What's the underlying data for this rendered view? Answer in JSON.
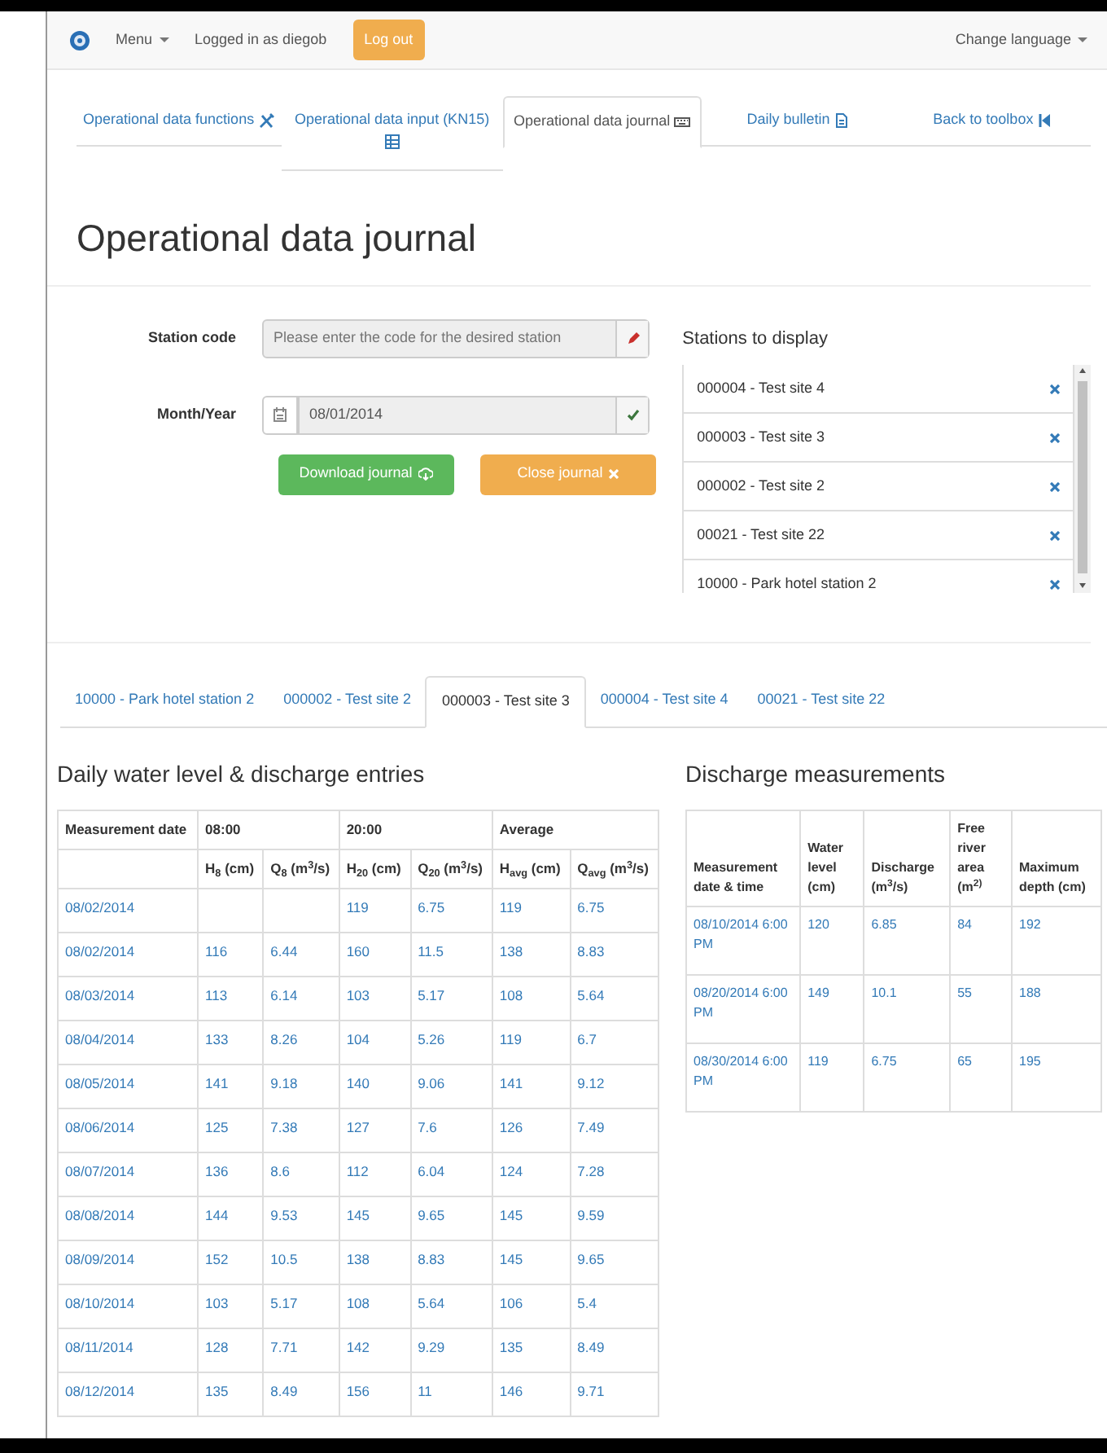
{
  "navbar": {
    "menu": "Menu",
    "user": "Logged in as diegob",
    "logout": "Log out",
    "language": "Change language"
  },
  "tabs": [
    {
      "label": "Operational data functions",
      "selected": false
    },
    {
      "label": "Operational data input (KN15)",
      "selected": false
    },
    {
      "label": "Operational data journal",
      "selected": true
    },
    {
      "label": "Daily bulletin",
      "selected": false
    },
    {
      "label": "Back to toolbox",
      "selected": false
    }
  ],
  "title": "Operational data journal",
  "form": {
    "station_code": {
      "label": "Station code",
      "placeholder": "Please enter the code for the desired station"
    },
    "month_year": {
      "label": "Month/Year",
      "value": "08/01/2014"
    },
    "buttons": [
      {
        "label": "Download journal",
        "kind": "download"
      },
      {
        "label": "Close journal",
        "kind": "close"
      }
    ]
  },
  "stations_panel": {
    "title": "Stations to display",
    "items": [
      "000004 - Test site 4",
      "000003 - Test site 3",
      "000002 - Test site 2",
      "00021 - Test site 22",
      "10000 - Park hotel station 2"
    ]
  },
  "station_tabs": [
    {
      "label": "10000 - Park hotel station 2",
      "selected": false
    },
    {
      "label": "000002 - Test site 2",
      "selected": false
    },
    {
      "label": "000003 - Test site 3",
      "selected": true
    },
    {
      "label": "000004 - Test site 4",
      "selected": false
    },
    {
      "label": "00021 - Test site 22",
      "selected": false
    }
  ],
  "daily": {
    "title": "Daily water level & discharge entries",
    "groups": [
      "Measurement date",
      "08:00",
      "20:00",
      "Average"
    ],
    "columns": [
      "",
      "H$_{8}$ (cm)",
      "Q$_{8}$ (m$^{3}$/s)",
      "H$_{20}$ (cm)",
      "Q$_{20}$ (m$^{3}$/s)",
      "H$_{avg}$ (cm)",
      "Q$_{avg}$ (m$^{3}$/s)"
    ],
    "rows": [
      [
        "08/02/2014",
        null,
        null,
        "119",
        "6.75",
        "119",
        "6.75"
      ],
      [
        "08/02/2014",
        "116",
        "6.44",
        "160",
        "11.5",
        "138",
        "8.83"
      ],
      [
        "08/03/2014",
        "113",
        "6.14",
        "103",
        "5.17",
        "108",
        "5.64"
      ],
      [
        "08/04/2014",
        "133",
        "8.26",
        "104",
        "5.26",
        "119",
        "6.7"
      ],
      [
        "08/05/2014",
        "141",
        "9.18",
        "140",
        "9.06",
        "141",
        "9.12"
      ],
      [
        "08/06/2014",
        "125",
        "7.38",
        "127",
        "7.6",
        "126",
        "7.49"
      ],
      [
        "08/07/2014",
        "136",
        "8.6",
        "112",
        "6.04",
        "124",
        "7.28"
      ],
      [
        "08/08/2014",
        "144",
        "9.53",
        "145",
        "9.65",
        "145",
        "9.59"
      ],
      [
        "08/09/2014",
        "152",
        "10.5",
        "138",
        "8.83",
        "145",
        "9.65"
      ],
      [
        "08/10/2014",
        "103",
        "5.17",
        "108",
        "5.64",
        "106",
        "5.4"
      ],
      [
        "08/11/2014",
        "128",
        "7.71",
        "142",
        "9.29",
        "135",
        "8.49"
      ],
      [
        "08/12/2014",
        "135",
        "8.49",
        "156",
        "11",
        "146",
        "9.71"
      ]
    ]
  },
  "discharge": {
    "title": "Discharge measurements",
    "columns": [
      "Measurement date & time",
      "Water level (cm)",
      "Discharge (m$^{3}$/s)",
      "Free river area (m$^{2)}$",
      "Maximum depth (cm)"
    ],
    "rows": [
      [
        "08/10/2014 6:00 PM",
        "120",
        "6.85",
        "84",
        "192"
      ],
      [
        "08/20/2014 6:00 PM",
        "149",
        "10.1",
        "55",
        "188"
      ],
      [
        "08/30/2014 6:00 PM",
        "119",
        "6.75",
        "65",
        "195"
      ]
    ]
  }
}
